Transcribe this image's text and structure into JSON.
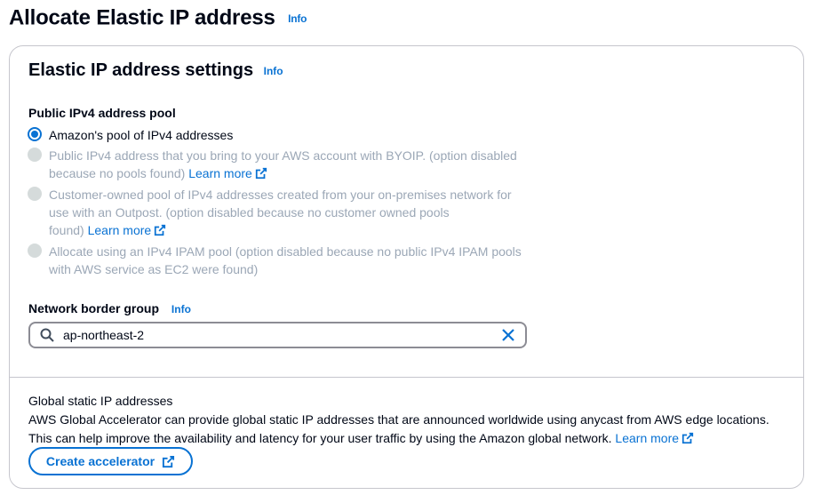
{
  "page": {
    "title": "Allocate Elastic IP address",
    "info": "Info"
  },
  "settings": {
    "header": "Elastic IP address settings",
    "info": "Info",
    "pool_label": "Public IPv4 address pool",
    "options": [
      {
        "label": "Amazon's pool of IPv4 addresses",
        "state": "selected"
      },
      {
        "line1": "Public IPv4 address that you bring to your AWS account with BYOIP. (option disabled",
        "line2": "because no pools found)",
        "learn_more": "Learn more",
        "state": "disabled"
      },
      {
        "line1": "Customer-owned pool of IPv4 addresses created from your on-premises network for",
        "line2": "use with an Outpost. (option disabled because no customer owned pools",
        "line3": "found)",
        "learn_more": "Learn more",
        "state": "disabled"
      },
      {
        "line1": "Allocate using an IPv4 IPAM pool (option disabled because no public IPv4 IPAM pools",
        "line2": "with AWS service as EC2 were found)",
        "state": "disabled"
      }
    ],
    "network_border_group": {
      "label": "Network border group",
      "info": "Info",
      "value": "ap-northeast-2"
    }
  },
  "global_static": {
    "title": "Global static IP addresses",
    "desc_line1": "AWS Global Accelerator can provide global static IP addresses that are announced worldwide using anycast from AWS edge locations.",
    "desc_line2": "This can help improve the availability and latency for your user traffic by using the Amazon global network.",
    "learn_more": "Learn more",
    "button": "Create accelerator"
  },
  "colors": {
    "link": "#0972d3",
    "text": "#000716",
    "disabled_text": "#9ba7b6",
    "border": "#c6c6cd"
  }
}
